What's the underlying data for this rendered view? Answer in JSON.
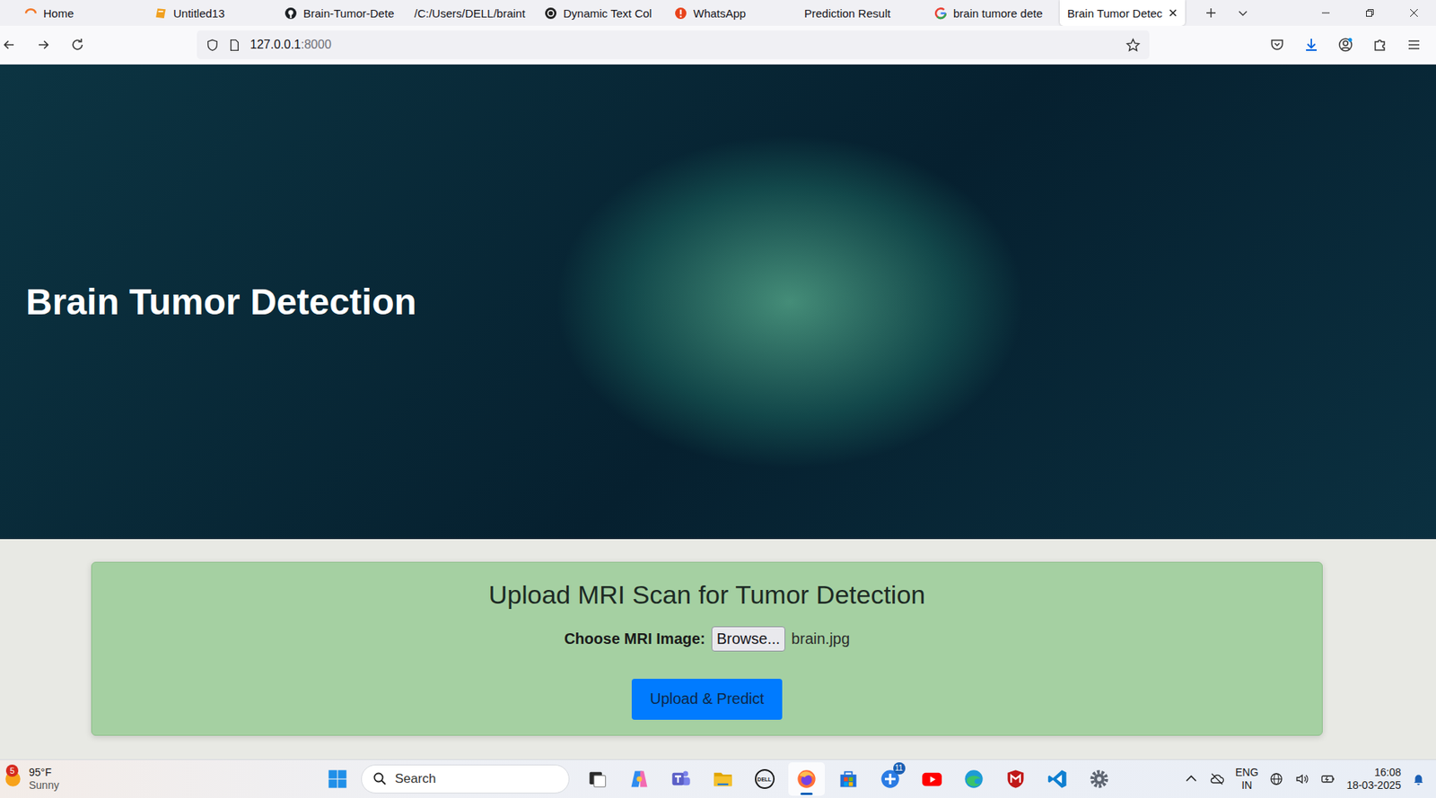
{
  "browser": {
    "tabs": [
      {
        "label": "Home",
        "kind": "ring",
        "selected": false
      },
      {
        "label": "Untitled13",
        "kind": "notebook",
        "selected": false
      },
      {
        "label": "Brain-Tumor-Dete",
        "kind": "github",
        "selected": false
      },
      {
        "label": "/C:/Users/DELL/braint",
        "kind": "none",
        "selected": false
      },
      {
        "label": "Dynamic Text Col",
        "kind": "openai",
        "selected": false
      },
      {
        "label": "WhatsApp",
        "kind": "alert",
        "selected": false
      },
      {
        "label": "Prediction Result",
        "kind": "none",
        "selected": false
      },
      {
        "label": "brain tumore dete",
        "kind": "google",
        "selected": false
      },
      {
        "label": "Brain Tumor Detec",
        "kind": "none",
        "selected": true
      }
    ],
    "address": {
      "host": "127.0.0.1",
      "port": ":8000"
    }
  },
  "page": {
    "title": "Brain Tumor Detection",
    "upload": {
      "heading": "Upload MRI Scan for Tumor Detection",
      "label": "Choose MRI Image:",
      "browse": "Browse...",
      "file": "brain.jpg",
      "submit": "Upload & Predict"
    }
  },
  "taskbar": {
    "weather": {
      "badge": "5",
      "temp": "95°F",
      "condition": "Sunny"
    },
    "search": "Search",
    "apps": [
      {
        "kind": "taskview",
        "color": "#2b2b2b",
        "active": false,
        "badge": "",
        "label": ""
      },
      {
        "kind": "copilot",
        "color": "#2f8cf0",
        "active": false,
        "badge": "",
        "label": ""
      },
      {
        "kind": "teams",
        "color": "#5b5fc7",
        "active": false,
        "badge": "",
        "label": ""
      },
      {
        "kind": "explorer",
        "color": "#f5c12e",
        "active": false,
        "badge": "",
        "label": ""
      },
      {
        "kind": "dell",
        "color": "#1a1a1a",
        "active": false,
        "badge": "",
        "label": "DELL"
      },
      {
        "kind": "firefox",
        "color": "#ff7139",
        "active": true,
        "badge": "",
        "label": ""
      },
      {
        "kind": "store",
        "color": "#1e6fd9",
        "active": false,
        "badge": "",
        "label": ""
      },
      {
        "kind": "todo",
        "color": "#2a7be4",
        "active": false,
        "badge": "11",
        "label": ""
      },
      {
        "kind": "youtube",
        "color": "#ff0000",
        "active": false,
        "badge": "",
        "label": ""
      },
      {
        "kind": "edge",
        "color": "#1d9bd6",
        "active": false,
        "badge": "",
        "label": ""
      },
      {
        "kind": "mcafee",
        "color": "#c01818",
        "active": false,
        "badge": "",
        "label": ""
      },
      {
        "kind": "vscode",
        "color": "#0f7fd0",
        "active": false,
        "badge": "",
        "label": ""
      },
      {
        "kind": "settings",
        "color": "#5d6470",
        "active": false,
        "badge": "",
        "label": ""
      }
    ],
    "tray": {
      "lang": "ENG",
      "region": "IN",
      "time": "16:08",
      "date": "18-03-2025"
    }
  }
}
